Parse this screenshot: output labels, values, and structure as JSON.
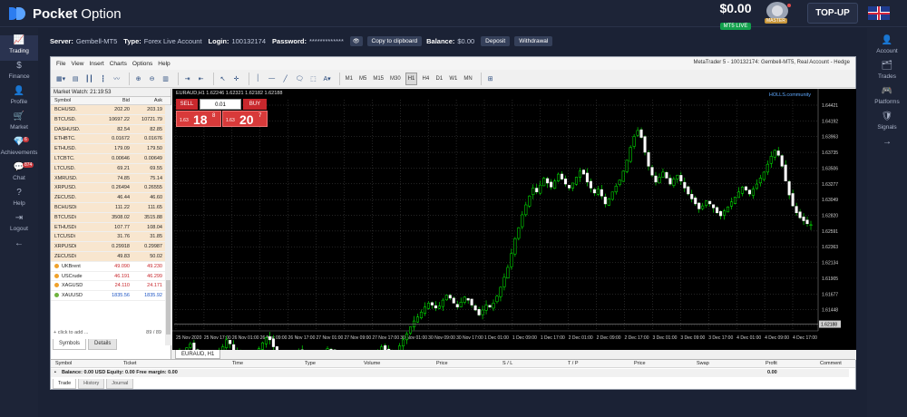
{
  "brand": {
    "name_bold": "Pocket",
    "name_rest": " Option"
  },
  "header": {
    "balance": "$0.00",
    "account_type": "MT5 LIVE",
    "avatar_badge": "MASTER",
    "topup_label": "TOP-UP"
  },
  "left_nav": [
    {
      "label": "Trading",
      "icon": "chart-line-icon",
      "glyph": "📈",
      "active": true
    },
    {
      "label": "Finance",
      "icon": "dollar-icon",
      "glyph": "$"
    },
    {
      "label": "Profile",
      "icon": "user-icon",
      "glyph": "👤"
    },
    {
      "label": "Market",
      "icon": "cart-icon",
      "glyph": "🛒"
    },
    {
      "label": "Achievements",
      "icon": "diamond-icon",
      "glyph": "💎",
      "badge": "6"
    },
    {
      "label": "Chat",
      "icon": "chat-icon",
      "glyph": "💬",
      "badge": "874"
    },
    {
      "label": "Help",
      "icon": "help-icon",
      "glyph": "?"
    },
    {
      "label": "Logout",
      "icon": "logout-icon",
      "glyph": "⇥"
    },
    {
      "label": "",
      "icon": "arrow-left-icon",
      "glyph": "←"
    }
  ],
  "right_nav": [
    {
      "label": "Account",
      "icon": "account-icon",
      "glyph": "👤"
    },
    {
      "label": "Trades",
      "icon": "trades-icon",
      "glyph": "🗂"
    },
    {
      "label": "Platforms",
      "icon": "platforms-icon",
      "glyph": "🎮"
    },
    {
      "label": "Signals",
      "icon": "signals-icon",
      "glyph": "🛡"
    },
    {
      "label": "",
      "icon": "arrow-right-icon",
      "glyph": "→"
    }
  ],
  "server_info": {
    "server_label": "Server:",
    "server": "Gembell-MT5",
    "type_label": "Type:",
    "type": "Forex Live Account",
    "login_label": "Login:",
    "login": "100132174",
    "password_label": "Password:",
    "password": "*************",
    "copy_label": "Copy to clipboard",
    "balance_label": "Balance:",
    "balance": "$0.00",
    "deposit_label": "Deposit",
    "withdrawal_label": "Withdrawal"
  },
  "terminal": {
    "menu": [
      "File",
      "View",
      "Insert",
      "Charts",
      "Options",
      "Help"
    ],
    "title": "MetaTrader 5 - 100132174: Gembell-MT5, Real Account - Hedge",
    "timeframes": [
      "M1",
      "M5",
      "M15",
      "M30",
      "H1",
      "H4",
      "D1",
      "W1",
      "MN"
    ],
    "active_timeframe": "H1"
  },
  "market_watch": {
    "title": "Market Watch: 21:19:53",
    "headers": {
      "symbol": "Symbol",
      "bid": "Bid",
      "ask": "Ask"
    },
    "rows": [
      {
        "symbol": "BCHUSD.",
        "bid": "202.20",
        "ask": "203.19",
        "kind": "crypto"
      },
      {
        "symbol": "BTCUSD.",
        "bid": "10697.22",
        "ask": "10721.79",
        "kind": "crypto"
      },
      {
        "symbol": "DASHUSD.",
        "bid": "82.54",
        "ask": "82.85",
        "kind": "crypto"
      },
      {
        "symbol": "ETHBTC.",
        "bid": "0.01672",
        "ask": "0.01676",
        "kind": "crypto"
      },
      {
        "symbol": "ETHUSD.",
        "bid": "179.09",
        "ask": "179.50",
        "kind": "crypto"
      },
      {
        "symbol": "LTCBTC.",
        "bid": "0.00646",
        "ask": "0.00649",
        "kind": "crypto"
      },
      {
        "symbol": "LTCUSD.",
        "bid": "69.21",
        "ask": "69.55",
        "kind": "crypto"
      },
      {
        "symbol": "XMRUSD.",
        "bid": "74.85",
        "ask": "75.14",
        "kind": "crypto"
      },
      {
        "symbol": "XRPUSD.",
        "bid": "0.26494",
        "ask": "0.26555",
        "kind": "crypto"
      },
      {
        "symbol": "ZECUSD.",
        "bid": "46.44",
        "ask": "46.60",
        "kind": "crypto"
      },
      {
        "symbol": "BCHUSDi",
        "bid": "111.22",
        "ask": "111.65",
        "kind": "crypto"
      },
      {
        "symbol": "BTCUSDi",
        "bid": "3508.02",
        "ask": "3515.88",
        "kind": "crypto"
      },
      {
        "symbol": "ETHUSDi",
        "bid": "107.77",
        "ask": "108.04",
        "kind": "crypto"
      },
      {
        "symbol": "LTCUSDi",
        "bid": "31.76",
        "ask": "31.85",
        "kind": "crypto"
      },
      {
        "symbol": "XRPUSDi",
        "bid": "0.29918",
        "ask": "0.29987",
        "kind": "crypto"
      },
      {
        "symbol": "ZECUSDi",
        "bid": "49.83",
        "ask": "50.02",
        "kind": "crypto"
      },
      {
        "symbol": "UKBrent",
        "bid": "49.090",
        "ask": "49.230",
        "kind": "comm",
        "dir": "dn"
      },
      {
        "symbol": "USCrude",
        "bid": "46.191",
        "ask": "46.299",
        "kind": "comm",
        "dir": "dn"
      },
      {
        "symbol": "XAGUSD",
        "bid": "24.110",
        "ask": "24.171",
        "kind": "comm",
        "dir": "dn"
      },
      {
        "symbol": "XAUUSD",
        "bid": "1835.56",
        "ask": "1835.92",
        "kind": "comm",
        "dir": "up",
        "dot": "g"
      }
    ],
    "add_label": "click to add ...",
    "count": "89 / 89",
    "tabs": [
      "Symbols",
      "Details"
    ]
  },
  "chart": {
    "window_title": "EURAUD,H1  1.62246 1.62321 1.62182 1.62188",
    "sell_label": "SELL",
    "buy_label": "BUY",
    "lot": "0.01",
    "sell_pre": "1.63",
    "sell_big": "18",
    "sell_sup": "8",
    "buy_pre": "1.63",
    "buy_big": "20",
    "buy_sup": "7",
    "hedge_badge": "HOLLS.community",
    "tab_label": "EURAUD, H1"
  },
  "chart_data": {
    "type": "candlestick",
    "symbol": "EURAUD",
    "timeframe": "H1",
    "ylim": [
      1.6212,
      1.6445
    ],
    "y_ticks": [
      "1.64421",
      "1.64192",
      "1.63963",
      "1.63735",
      "1.63506",
      "1.63277",
      "1.63049",
      "1.62820",
      "1.62591",
      "1.62363",
      "1.62134",
      "1.61905",
      "1.61677",
      "1.61448",
      "1.61219"
    ],
    "current_price": "1.62188",
    "x_ticks": [
      "25 Nov 2020",
      "25 Nov 17:00",
      "26 Nov 01:00",
      "26 Nov 09:00",
      "26 Nov 17:00",
      "27 Nov 01:00",
      "27 Nov 09:00",
      "27 Nov 17:00",
      "30 Nov 01:00",
      "30 Nov 09:00",
      "30 Nov 17:00",
      "1 Dec 01:00",
      "1 Dec 09:00",
      "1 Dec 17:00",
      "2 Dec 01:00",
      "2 Dec 09:00",
      "2 Dec 17:00",
      "3 Dec 01:00",
      "3 Dec 09:00",
      "3 Dec 17:00",
      "4 Dec 01:00",
      "4 Dec 09:00",
      "4 Dec 17:00"
    ],
    "close_path": [
      1.6192,
      1.619,
      1.6195,
      1.6199,
      1.6193,
      1.6188,
      1.6185,
      1.618,
      1.6177,
      1.6183,
      1.6188,
      1.619,
      1.6196,
      1.6203,
      1.6199,
      1.6193,
      1.6189,
      1.6185,
      1.6181,
      1.6177,
      1.6183,
      1.6189,
      1.6194,
      1.62,
      1.6205,
      1.6203,
      1.6196,
      1.619,
      1.6184,
      1.618,
      1.6177,
      1.6181,
      1.6187,
      1.6192,
      1.6189,
      1.6182,
      1.6177,
      1.6174,
      1.6178,
      1.6183,
      1.6189,
      1.6194,
      1.6192,
      1.6186,
      1.6181,
      1.6177,
      1.6176,
      1.6181,
      1.6186,
      1.6184,
      1.6179,
      1.6175,
      1.6173,
      1.6178,
      1.6185,
      1.6191,
      1.6196,
      1.6193,
      1.6188,
      1.6184,
      1.619,
      1.6197,
      1.6203,
      1.6209,
      1.6216,
      1.6222,
      1.6226,
      1.6231,
      1.6236,
      1.624,
      1.6238,
      1.6235,
      1.6237,
      1.6243,
      1.6248,
      1.6245,
      1.624,
      1.6236,
      1.6241,
      1.6246,
      1.6243,
      1.6238,
      1.6233,
      1.6228,
      1.6233,
      1.6238,
      1.6236,
      1.624,
      1.6247,
      1.6256,
      1.6266,
      1.6276,
      1.629,
      1.6305,
      1.6316,
      1.6329,
      1.6339,
      1.6348,
      1.6356,
      1.6352,
      1.6359,
      1.6366,
      1.6361,
      1.6357,
      1.6363,
      1.637,
      1.6365,
      1.636,
      1.6356,
      1.6361,
      1.6367,
      1.6373,
      1.637,
      1.6362,
      1.6356,
      1.6351,
      1.6355,
      1.6348,
      1.634,
      1.6345,
      1.6352,
      1.6358,
      1.6364,
      1.6373,
      1.6384,
      1.6397,
      1.6408,
      1.6414,
      1.6407,
      1.6392,
      1.6378,
      1.6369,
      1.6362,
      1.6367,
      1.6372,
      1.6366,
      1.636,
      1.6365,
      1.6369,
      1.6363,
      1.6356,
      1.635,
      1.6345,
      1.634,
      1.6335,
      1.6338,
      1.6343,
      1.634,
      1.6336,
      1.6331,
      1.6328,
      1.6333,
      1.6337,
      1.6342,
      1.6347,
      1.6352,
      1.6357,
      1.6354,
      1.635,
      1.6355,
      1.636,
      1.6366,
      1.6372,
      1.638,
      1.6388,
      1.6394,
      1.6389,
      1.6378,
      1.6363,
      1.6349,
      1.6338,
      1.6331,
      1.6326,
      1.6323,
      1.632,
      1.6319
    ]
  },
  "toolbox": {
    "headers": [
      "Symbol",
      "Ticket",
      "Time",
      "Type",
      "Volume",
      "Price",
      "S / L",
      "T / P",
      "Price",
      "Swap",
      "Profit",
      "Comment"
    ],
    "balance_line": "Balance: 0.00 USD  Equity: 0.00  Free margin: 0.00",
    "profit": "0.00",
    "tabs": [
      "Trade",
      "History",
      "Journal"
    ]
  }
}
